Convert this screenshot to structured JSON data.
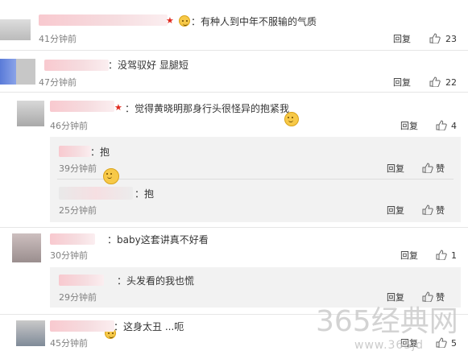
{
  "comments": [
    {
      "text": "：有种人到中年不服输的气质",
      "time": "41分钟前",
      "reply": "回复",
      "likes": "23"
    },
    {
      "text": "：没驾驭好 显腿短",
      "time": "47分钟前",
      "reply": "回复",
      "likes": "22"
    },
    {
      "text": "：觉得黄晓明那身行头很怪异的抱紧我",
      "time": "46分钟前",
      "reply": "回复",
      "likes": "4",
      "replies": [
        {
          "text": "：抱",
          "time": "39分钟前",
          "reply": "回复",
          "likes": "赞"
        },
        {
          "text": "：抱",
          "time": "25分钟前",
          "reply": "回复",
          "likes": "赞"
        }
      ]
    },
    {
      "text": "：baby这套讲真不好看",
      "time": "30分钟前",
      "reply": "回复",
      "likes": "1",
      "replies": [
        {
          "text": "：头发看的我也慌",
          "time": "29分钟前",
          "reply": "回复",
          "likes": "赞"
        }
      ]
    },
    {
      "text": "：这身太丑 ...呃",
      "time": "45分钟前",
      "reply": "回复",
      "likes": "5"
    }
  ],
  "watermark": {
    "main": "365经典网",
    "sub": "www.365jd"
  },
  "colors": {
    "username_blur": "#f8c9cf",
    "time": "#808080",
    "sub_bg": "#f2f2f2"
  },
  "icons": {
    "like": "thumb-up-icon",
    "badge": "vip-badge-icon",
    "emoji": "smiley-emoji-icon",
    "star": "star-icon"
  }
}
